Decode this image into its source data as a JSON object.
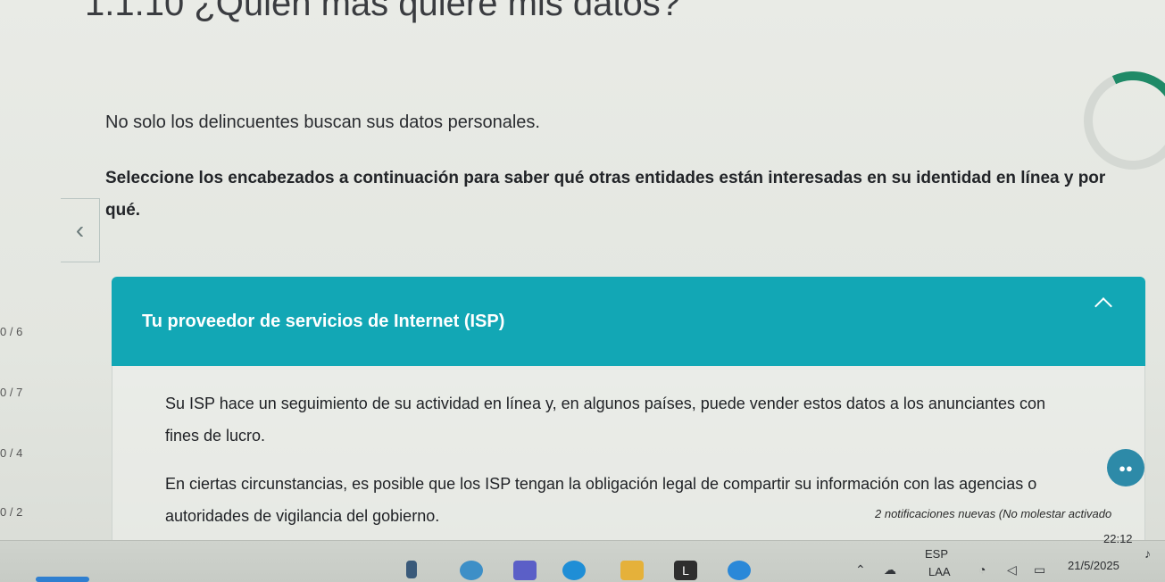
{
  "page": {
    "title": "1.1.10 ¿Quién más quiere mis datos?",
    "intro": "No solo los delincuentes buscan sus datos personales.",
    "instruction": "Seleccione los encabezados a continuación para saber qué otras entidades están interesadas en su identidad en línea y por qué."
  },
  "progress": {
    "items": [
      "0 / 6",
      "0 / 7",
      "0 / 4",
      "0 / 2"
    ]
  },
  "accordion": {
    "title": "Tu proveedor de servicios de Internet (ISP)",
    "paragraphs": [
      "Su ISP hace un seguimiento de su actividad en línea y, en algunos países, puede vender estos datos a los anunciantes con fines de lucro.",
      "En ciertas circunstancias, es posible que los ISP tengan la obligación legal de compartir su información con las agencias o autoridades de vigilancia del gobierno."
    ]
  },
  "notification": {
    "text": "2 notificaciones nuevas (No molestar activado"
  },
  "taskbar": {
    "language_top": "ESP",
    "language_bottom": "LAA",
    "time": "22:12",
    "date": "21/5/2025"
  },
  "colors": {
    "accordion_bg": "#12a7b5",
    "ring_progress": "#1f8a67"
  },
  "icons": {
    "back": "chevron-left-icon",
    "accordion_toggle": "chevron-up-icon"
  }
}
